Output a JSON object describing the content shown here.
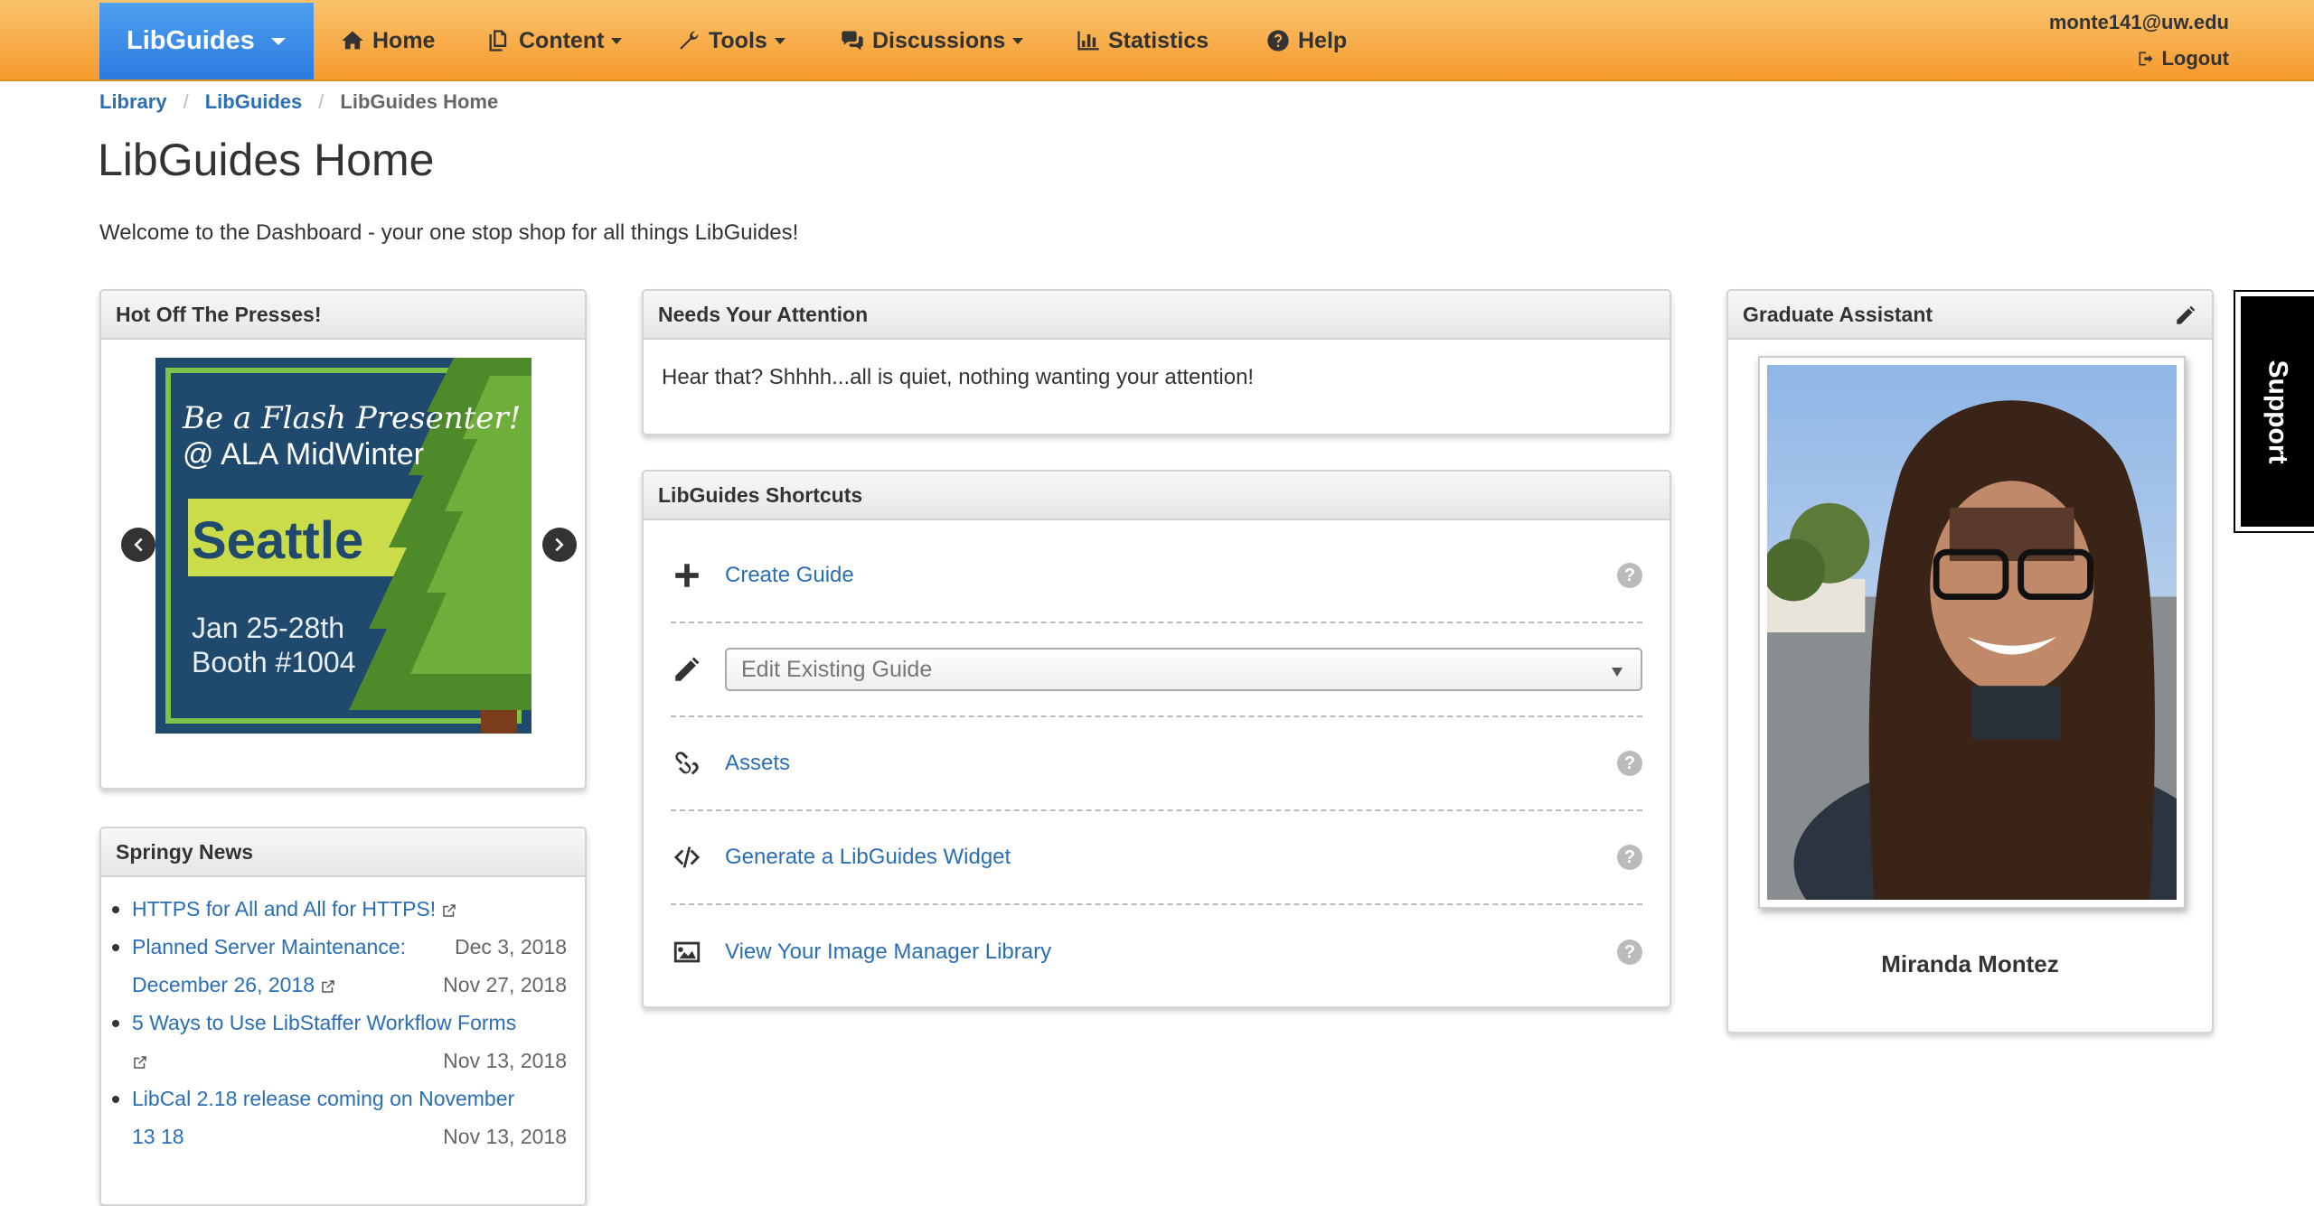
{
  "nav": {
    "brand": "LibGuides",
    "items": [
      {
        "label": "Home",
        "icon": "home-icon"
      },
      {
        "label": "Content",
        "icon": "content-icon"
      },
      {
        "label": "Tools",
        "icon": "wrench-icon"
      },
      {
        "label": "Discussions",
        "icon": "comments-icon"
      },
      {
        "label": "Statistics",
        "icon": "bar-chart-icon"
      },
      {
        "label": "Help",
        "icon": "question-circle-icon"
      }
    ],
    "user_email": "monte141@uw.edu",
    "logout": "Logout"
  },
  "breadcrumb": {
    "items": [
      "Library",
      "LibGuides"
    ],
    "current": "LibGuides Home"
  },
  "page": {
    "title": "LibGuides Home",
    "welcome": "Welcome to the Dashboard - your one stop shop for all things LibGuides!"
  },
  "hot_presses": {
    "title": "Hot Off The Presses!",
    "slide": {
      "line1": "Be a Flash Presenter!",
      "line2": "@ ALA MidWinter",
      "city": "Seattle",
      "dates": "Jan 25-28th",
      "booth": "Booth #1004"
    }
  },
  "news": {
    "title": "Springy News",
    "items": [
      {
        "title": "HTTPS for All and All for HTTPS!",
        "date": ""
      },
      {
        "title": "Planned Server Maintenance: December 26, 2018",
        "title_a": "Planned Server Maintenance:",
        "title_b": "December 26, 2018",
        "date": "Dec 3, 2018",
        "date2": "Nov 27, 2018"
      },
      {
        "title_a": "5 Ways to Use LibStaffer Workflow Forms",
        "date": "Nov 13, 2018"
      },
      {
        "title_a": "LibCal 2.18 release coming on November",
        "title_b": "13 18",
        "date": "Nov 13, 2018"
      }
    ]
  },
  "attention": {
    "title": "Needs Your Attention",
    "message": "Hear that? Shhhh...all is quiet, nothing wanting your attention!"
  },
  "shortcuts": {
    "title": "LibGuides Shortcuts",
    "create": "Create Guide",
    "edit_placeholder": "Edit Existing Guide",
    "assets": "Assets",
    "widget": "Generate a LibGuides Widget",
    "image_manager": "View Your Image Manager Library",
    "help": "?"
  },
  "assistant": {
    "title": "Graduate Assistant",
    "name": "Miranda Montez"
  },
  "support": {
    "label": "Support"
  },
  "colors": {
    "nav_orange": "#f59a2e",
    "brand_blue": "#2c7be0",
    "link": "#2a6eb6"
  }
}
